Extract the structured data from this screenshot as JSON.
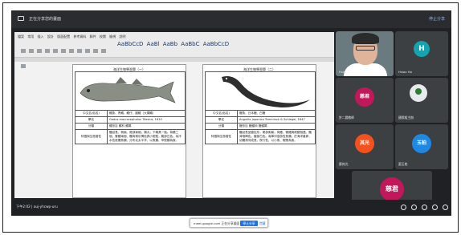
{
  "meet": {
    "window_title": "正在分享您的畫面",
    "top_right_link": "停止分享",
    "meeting_code": "下午2:02 | auj-yhcwp-uru",
    "share_notice": "meet.google.com 正在分享畫面",
    "stop_share_button": "停止分享",
    "hide_button": "隱藏"
  },
  "ribbon": {
    "tabs": "檔案 常用 插入 設計 版面配置 參考資料 郵件 校閱 檢視 說明",
    "styles": "AaBbCcD AaBl AaBb AaBbC AaBbCcD"
  },
  "doc_left": {
    "caption": "海洋生物學習單（一）",
    "rows": [
      {
        "k": "中文名(俗名)",
        "v": "鱈魚、青鱈、鱈仔、圓鱈（大頭鱈）"
      },
      {
        "k": "學名",
        "v": "Gadus macrocephalus Tilesius, 1810"
      },
      {
        "k": "分類",
        "v": "鱈形目 鱈科 鱈屬"
      },
      {
        "k": "特徵與生態習性",
        "v": "體延長，側扁，尾部漸細，頭大；下頜具一鬚。背鰭三個，臀鰭兩個，體背側灰褐色具小斑點，腹部白色。為冷水性底棲魚類，分布北太平洋，以魚類、甲殼類為食。"
      }
    ]
  },
  "doc_right": {
    "caption": "海洋生物學習單（二）",
    "rows": [
      {
        "k": "中文名(俗名)",
        "v": "鰻魚、日本鰻、白鰻"
      },
      {
        "k": "學名",
        "v": "Anguilla japonica Temminck & Schlegel, 1847"
      },
      {
        "k": "分類",
        "v": "鰻形目 鰻鱺科 鰻鱺屬"
      },
      {
        "k": "特徵與生態習性",
        "v": "體延長呈圓柱形，尾部側扁；背鰭、臀鰭與尾鰭相連。體背暗褐色，腹部白色。為降河洄游性魚類，於海洋產卵，幼鰻溯河成長，夜行性，以小魚、蝦蟹為食。"
      }
    ]
  },
  "participants": {
    "p1_name": "Hsieh",
    "p1_initial": "H",
    "p2_name": "Hsiao Ho",
    "p3_name": "許二晨教師",
    "p3_initial": "慈君",
    "p4_name": "國際組主辦",
    "p5_name": "廖其光",
    "p5_initial": "其光",
    "p6_name": "蕭玉柏",
    "p6_initial": "玉柏",
    "p7_name": "",
    "p7_initial": "慈君"
  },
  "colors": {
    "av_h": "#12a4af",
    "av_cijun": "#c2185b",
    "av_qiguang": "#f4511e",
    "av_yubo": "#1e88e5"
  }
}
